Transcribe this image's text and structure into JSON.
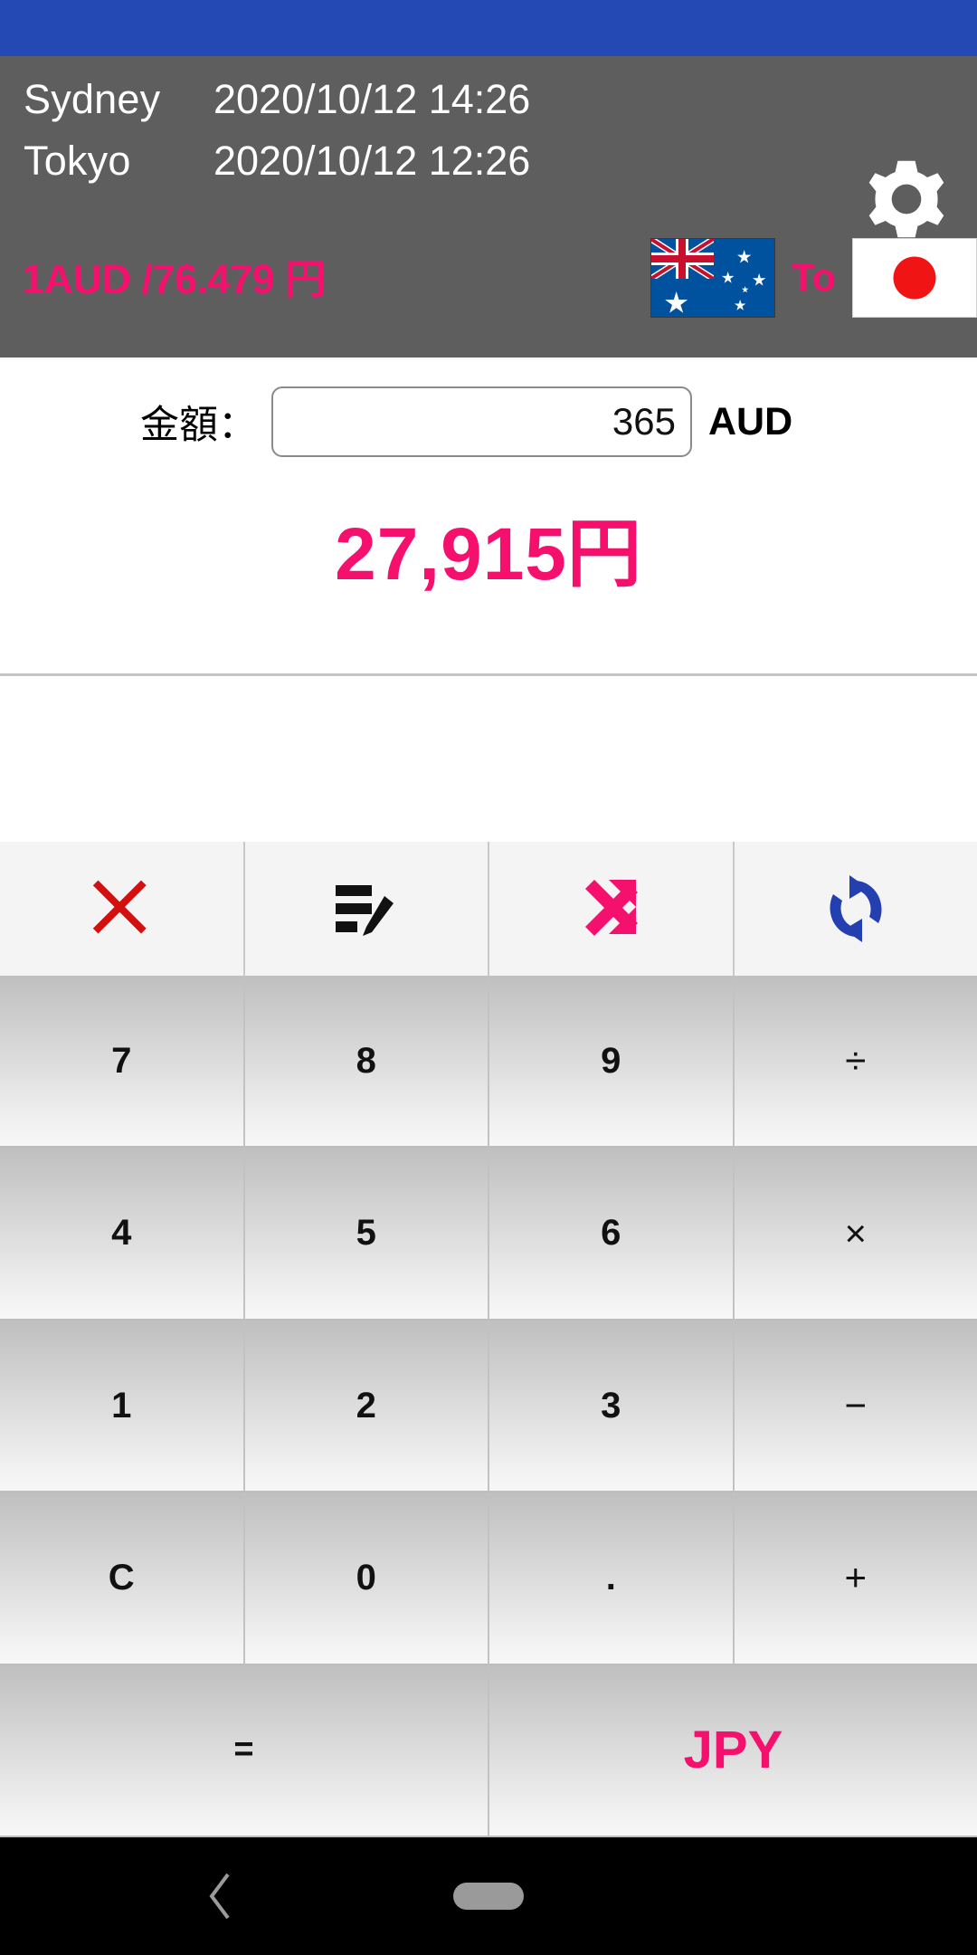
{
  "theme": {
    "status_bar_color": "#2449b4",
    "header_bg": "#5e5e5e",
    "accent_pink": "#f5106e",
    "key_text": "#111111",
    "nav_bg": "#000000"
  },
  "header": {
    "clocks": [
      {
        "city": "Sydney",
        "datetime": "2020/10/12 14:26"
      },
      {
        "city": "Tokyo",
        "datetime": "2020/10/12 12:26"
      }
    ],
    "rate_text": "1AUD /76.479 円",
    "settings_icon": "gear-icon",
    "from_flag": "australia-flag",
    "to_label": "To",
    "to_flag": "japan-flag"
  },
  "converter": {
    "amount_label": "金額：",
    "amount_value": "365",
    "amount_placeholder": "0",
    "from_currency": "AUD",
    "result": "27,915円"
  },
  "toolbar": {
    "items": [
      {
        "name": "close-icon",
        "color": "#d40f0f"
      },
      {
        "name": "edit-list-icon",
        "color": "#111111"
      },
      {
        "name": "swap-icon",
        "color": "#f5106e"
      },
      {
        "name": "refresh-icon",
        "color": "#2440b0"
      }
    ]
  },
  "keypad": {
    "rows": [
      [
        {
          "label": "7",
          "type": "digit"
        },
        {
          "label": "8",
          "type": "digit"
        },
        {
          "label": "9",
          "type": "digit"
        },
        {
          "label": "÷",
          "type": "operator"
        }
      ],
      [
        {
          "label": "4",
          "type": "digit"
        },
        {
          "label": "5",
          "type": "digit"
        },
        {
          "label": "6",
          "type": "digit"
        },
        {
          "label": "×",
          "type": "operator"
        }
      ],
      [
        {
          "label": "1",
          "type": "digit"
        },
        {
          "label": "2",
          "type": "digit"
        },
        {
          "label": "3",
          "type": "digit"
        },
        {
          "label": "−",
          "type": "operator"
        }
      ],
      [
        {
          "label": "C",
          "type": "clear"
        },
        {
          "label": "0",
          "type": "digit"
        },
        {
          "label": ".",
          "type": "decimal"
        },
        {
          "label": "+",
          "type": "operator"
        }
      ],
      [
        {
          "label": "=",
          "type": "equals",
          "span": 2
        },
        {
          "label": "JPY",
          "type": "currency",
          "span": 2
        }
      ]
    ]
  },
  "navbar": {
    "back": "back-chevron-icon",
    "home": "home-pill-icon"
  }
}
